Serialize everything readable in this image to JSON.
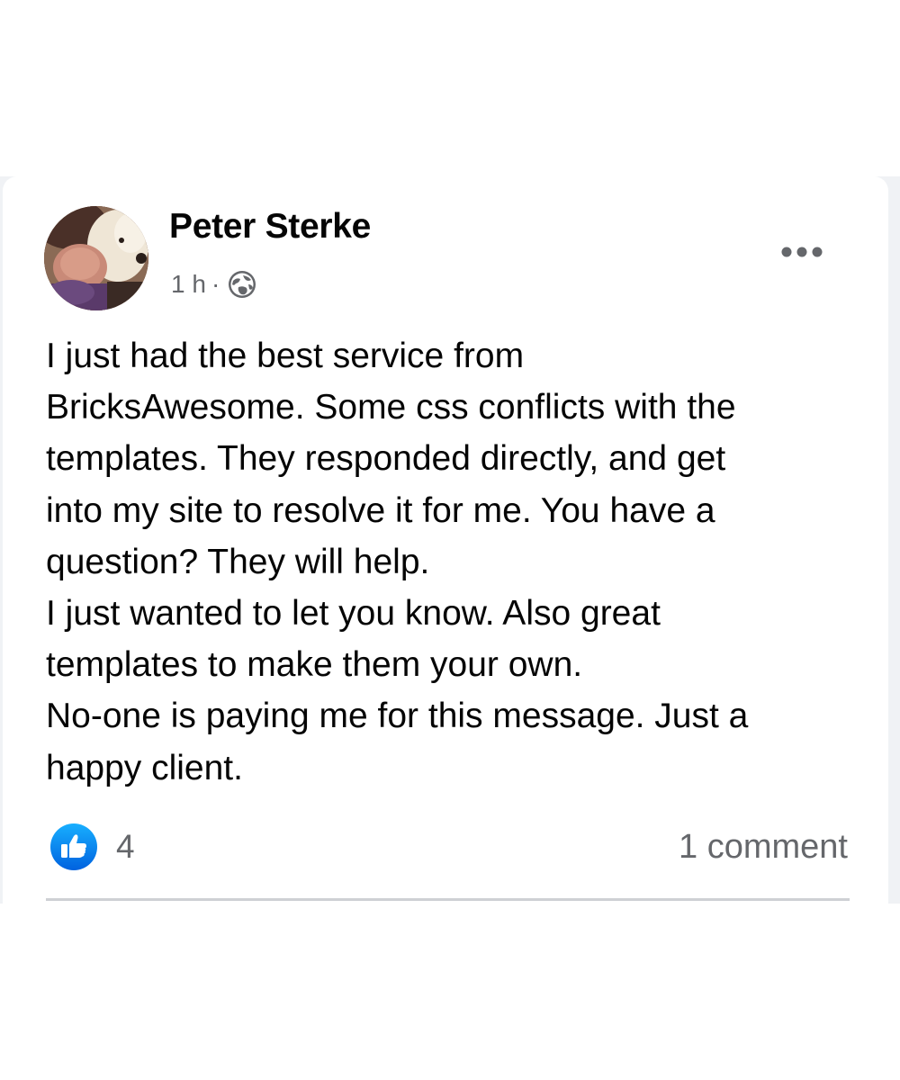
{
  "post": {
    "author": "Peter Sterke",
    "time": "1 h",
    "separator": "·",
    "privacy_icon": "globe-icon",
    "more_icon": "more-options-icon",
    "text_lines": [
      "I just had the best service from",
      "BricksAwesome. Some css conflicts with the",
      "templates. They responded directly, and get",
      "into my site to resolve it for me. You have a",
      "question? They will help.",
      "I just wanted to let you know. Also great",
      "templates to make them your own.",
      "No-one is paying me for this message. Just a",
      "happy client."
    ],
    "reactions": {
      "icon": "like-icon",
      "count": "4"
    },
    "comments": "1 comment"
  },
  "colors": {
    "text_primary": "#050505",
    "text_secondary": "#65676b",
    "like_blue": "#1877f2",
    "divider": "#ced0d4",
    "feed_background": "#f0f2f5"
  }
}
